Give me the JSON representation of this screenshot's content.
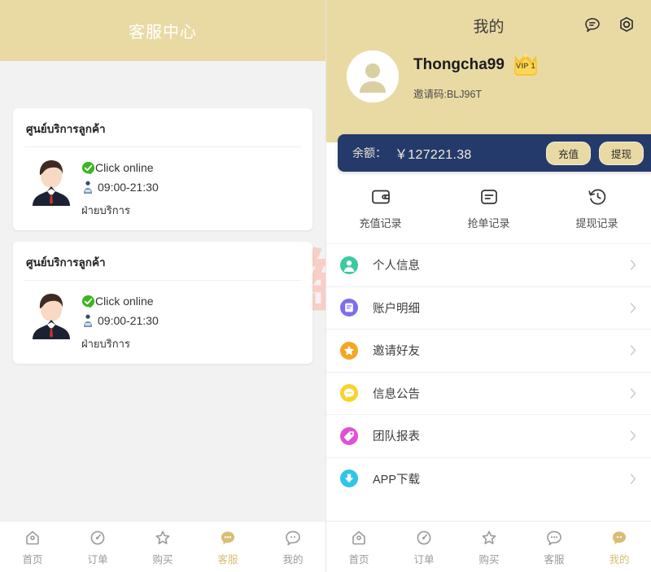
{
  "left": {
    "header": {
      "title": "客服中心"
    },
    "cards": [
      {
        "title": "ศูนย์บริการลูกค้า",
        "online_label": "Click online",
        "hours": "09:00-21:30",
        "department": "ฝ่ายบริการ",
        "avatar_icon": "support-agent-avatar",
        "check_icon": "green-check-icon",
        "agent_icon": "agent-icon"
      },
      {
        "title": "ศูนย์บริการลูกค้า",
        "online_label": "Click online",
        "hours": "09:00-21:30",
        "department": "ฝ่ายบริการ",
        "avatar_icon": "support-agent-avatar",
        "check_icon": "green-check-icon",
        "agent_icon": "agent-icon"
      }
    ],
    "tabbar": [
      {
        "label": "首页",
        "icon": "home-icon",
        "active": false
      },
      {
        "label": "订单",
        "icon": "clock-order-icon",
        "active": false
      },
      {
        "label": "购买",
        "icon": "star-icon",
        "active": false
      },
      {
        "label": "客服",
        "icon": "service-chat-icon",
        "active": true
      },
      {
        "label": "我的",
        "icon": "profile-chat-icon",
        "active": false
      }
    ]
  },
  "right": {
    "header": {
      "title": "我的",
      "message_icon": "message-bubble-icon",
      "settings_icon": "settings-hex-icon"
    },
    "user": {
      "avatar_icon": "user-avatar-icon",
      "name": "Thongcha99",
      "vip_badge": "VIP 1",
      "invite_code": "邀请码:BLJ96T"
    },
    "balance": {
      "label": "余额：",
      "amount": "￥127221.38",
      "recharge_label": "充值",
      "withdraw_label": "提现"
    },
    "shortcuts": [
      {
        "label": "充值记录",
        "icon": "wallet-icon"
      },
      {
        "label": "抢单记录",
        "icon": "list-doc-icon"
      },
      {
        "label": "提现记录",
        "icon": "clock-history-icon"
      }
    ],
    "menu": [
      {
        "label": "个人信息",
        "icon": "person-circle-icon",
        "color": "#3bc9a0"
      },
      {
        "label": "账户明细",
        "icon": "account-detail-icon",
        "color": "#7b6ef0"
      },
      {
        "label": "邀请好友",
        "icon": "star-circle-icon",
        "color": "#f5a623"
      },
      {
        "label": "信息公告",
        "icon": "announcement-icon",
        "color": "#f7d32e"
      },
      {
        "label": "团队报表",
        "icon": "team-report-icon",
        "color": "#e24fd6"
      },
      {
        "label": "APP下载",
        "icon": "download-icon",
        "color": "#2fc4ec"
      }
    ],
    "tabbar": [
      {
        "label": "首页",
        "icon": "home-icon",
        "active": false
      },
      {
        "label": "订单",
        "icon": "clock-order-icon",
        "active": false
      },
      {
        "label": "购买",
        "icon": "star-icon",
        "active": false
      },
      {
        "label": "客服",
        "icon": "service-chat-icon",
        "active": false
      },
      {
        "label": "我的",
        "icon": "profile-chat-icon",
        "active": true
      }
    ]
  },
  "watermark": {
    "text": "一淘模版",
    "logo_icon": "taobao-template-logo"
  },
  "colors": {
    "header_tan": "#e9daa4",
    "accent_tan": "#d9bd74",
    "balance_navy": "#243a6b",
    "page_gray": "#f2f2f2",
    "watermark_pink": "#f7cfc6"
  }
}
